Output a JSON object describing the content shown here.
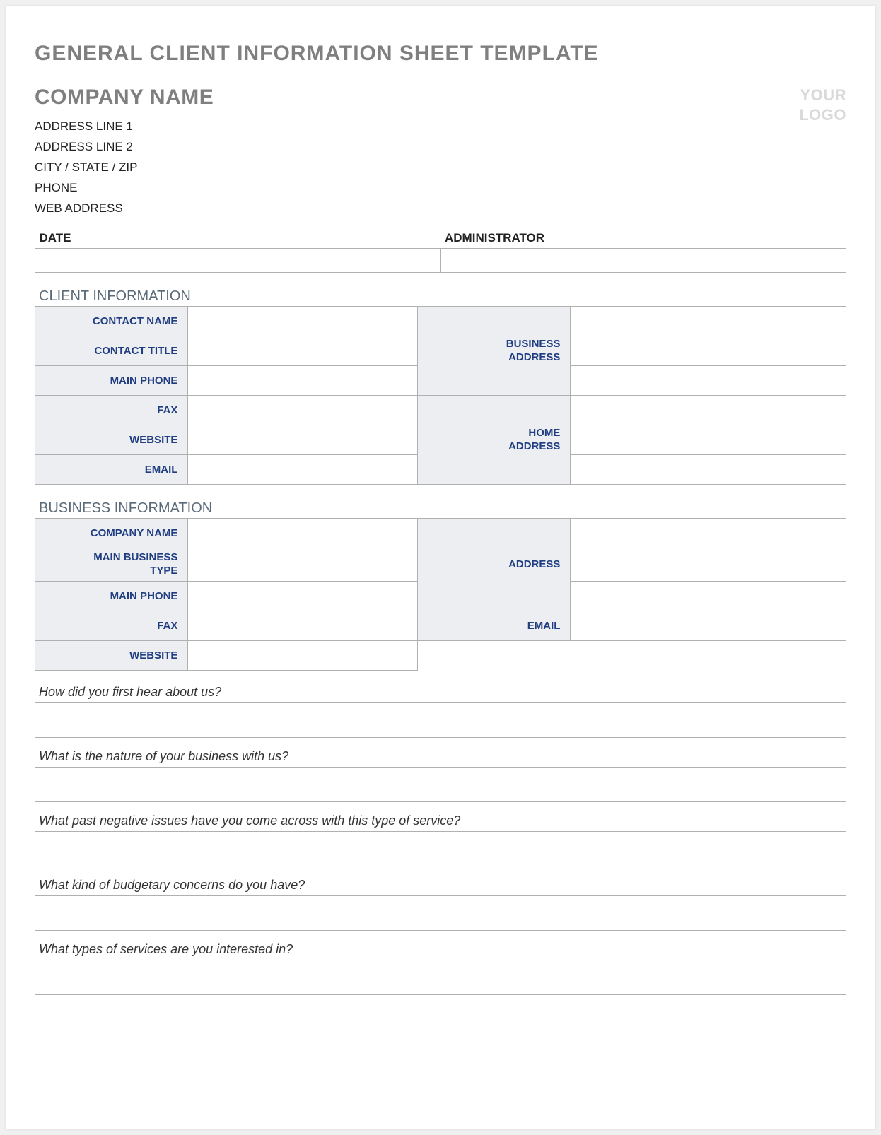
{
  "title": "GENERAL CLIENT INFORMATION SHEET TEMPLATE",
  "logo_placeholder": {
    "line1": "YOUR",
    "line2": "LOGO"
  },
  "company": {
    "name": "COMPANY NAME",
    "address_line_1": "ADDRESS LINE 1",
    "address_line_2": "ADDRESS LINE 2",
    "city_state_zip": "CITY / STATE / ZIP",
    "phone": "PHONE",
    "web": "WEB ADDRESS"
  },
  "meta": {
    "date_label": "DATE",
    "date_value": "",
    "admin_label": "ADMINISTRATOR",
    "admin_value": ""
  },
  "client_info": {
    "heading": "CLIENT INFORMATION",
    "labels": {
      "contact_name": "CONTACT NAME",
      "contact_title": "CONTACT TITLE",
      "main_phone": "MAIN PHONE",
      "fax": "FAX",
      "website": "WEBSITE",
      "email": "EMAIL",
      "business_address_l1": "BUSINESS",
      "business_address_l2": "ADDRESS",
      "home_address_l1": "HOME",
      "home_address_l2": "ADDRESS"
    },
    "values": {
      "contact_name": "",
      "contact_title": "",
      "main_phone": "",
      "fax": "",
      "website": "",
      "email": "",
      "business_address_1": "",
      "business_address_2": "",
      "business_address_3": "",
      "home_address_1": "",
      "home_address_2": "",
      "home_address_3": ""
    }
  },
  "business_info": {
    "heading": "BUSINESS INFORMATION",
    "labels": {
      "company_name": "COMPANY NAME",
      "main_business_type_l1": "MAIN BUSINESS",
      "main_business_type_l2": "TYPE",
      "main_phone": "MAIN PHONE",
      "fax": "FAX",
      "website": "WEBSITE",
      "address": "ADDRESS",
      "email": "EMAIL"
    },
    "values": {
      "company_name": "",
      "main_business_type": "",
      "main_phone": "",
      "fax": "",
      "website": "",
      "address_1": "",
      "address_2": "",
      "address_3": "",
      "email": ""
    }
  },
  "questions": [
    {
      "label": "How did you first hear about us?",
      "value": ""
    },
    {
      "label": "What is the nature of your business with us?",
      "value": ""
    },
    {
      "label": "What past negative issues have you come across with this type of service?",
      "value": ""
    },
    {
      "label": "What kind of budgetary concerns do you have?",
      "value": ""
    },
    {
      "label": "What types of services are you interested in?",
      "value": ""
    }
  ]
}
